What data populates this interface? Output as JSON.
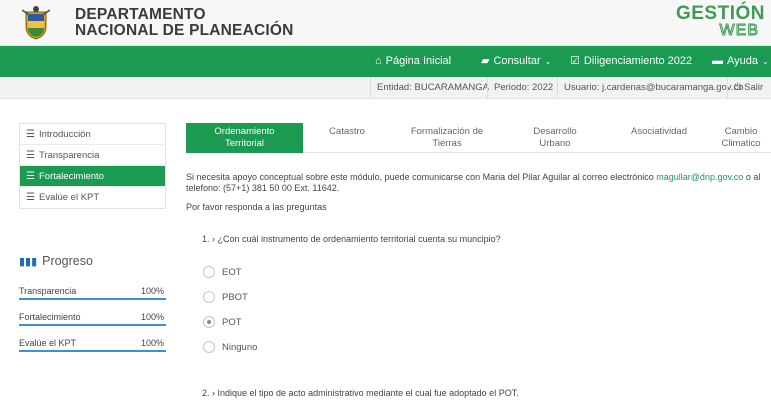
{
  "header": {
    "title_line1": "DEPARTAMENTO",
    "title_line2": "NACIONAL DE PLANEACIÓN",
    "logo_top": "GESTIÓN",
    "logo_bottom": "WEB",
    "brand_color": "#1b9a52"
  },
  "nav": {
    "home": {
      "label": "Página Inicial",
      "icon": "home-icon"
    },
    "consult": {
      "label": "Consultar",
      "icon": "folder-icon"
    },
    "diligence": {
      "label": "Diligenciamiento 2022",
      "icon": "edit-icon"
    },
    "help": {
      "label": "Ayuda",
      "icon": "chat-icon"
    }
  },
  "infobar": {
    "entity": "Entidad: BUCARAMANGA",
    "period": "Periodo: 2022",
    "user": "Usuario: j.cardenas@bucaramanga.gov.co",
    "logout": "Salir"
  },
  "sidebar": {
    "items": [
      {
        "label": "Introducción",
        "active": false
      },
      {
        "label": "Transparencia",
        "active": false
      },
      {
        "label": "Fortalecimiento",
        "active": true
      },
      {
        "label": "Evalúe el KPT",
        "active": false
      }
    ]
  },
  "progress": {
    "title": "Progreso",
    "rows": [
      {
        "label": "Transparencia",
        "value": "100%"
      },
      {
        "label": "Fortalecimiento",
        "value": "100%"
      },
      {
        "label": "Evalúe el KPT",
        "value": "100%"
      }
    ]
  },
  "tabs": [
    {
      "line1": "Ordenamiento",
      "line2": "Territorial",
      "active": true
    },
    {
      "line1": "Catastro",
      "line2": "",
      "active": false
    },
    {
      "line1": "Formalización de",
      "line2": "Tierras",
      "active": false
    },
    {
      "line1": "Desarrollo",
      "line2": "Urbano",
      "active": false
    },
    {
      "line1": "Asociatividad",
      "line2": "",
      "active": false
    },
    {
      "line1": "Cambio",
      "line2": "Climatico",
      "active": false
    }
  ],
  "content": {
    "intro_text": "Si necesita apoyo conceptual sobre este módulo, puede comunicarse con Maria del Pilar Aguilar al correo electrónico",
    "intro_email": "magullar@dnp.gov.co",
    "intro_tail": "o al telefono:",
    "intro_phone": "(57+1) 381 50 00 Ext. 11642.",
    "please": "Por favor responda a las preguntas",
    "question1": "1. › ¿Con cuál instrumento de ordenamiento territorial cuenta su muncipio?",
    "options": [
      {
        "label": "EOT",
        "checked": false
      },
      {
        "label": "PBOT",
        "checked": false
      },
      {
        "label": "POT",
        "checked": true
      },
      {
        "label": "Ninguno",
        "checked": false
      }
    ],
    "question2": "2. › Indique el tipo de acto administrativo mediante el cual fue adoptado el POT."
  }
}
